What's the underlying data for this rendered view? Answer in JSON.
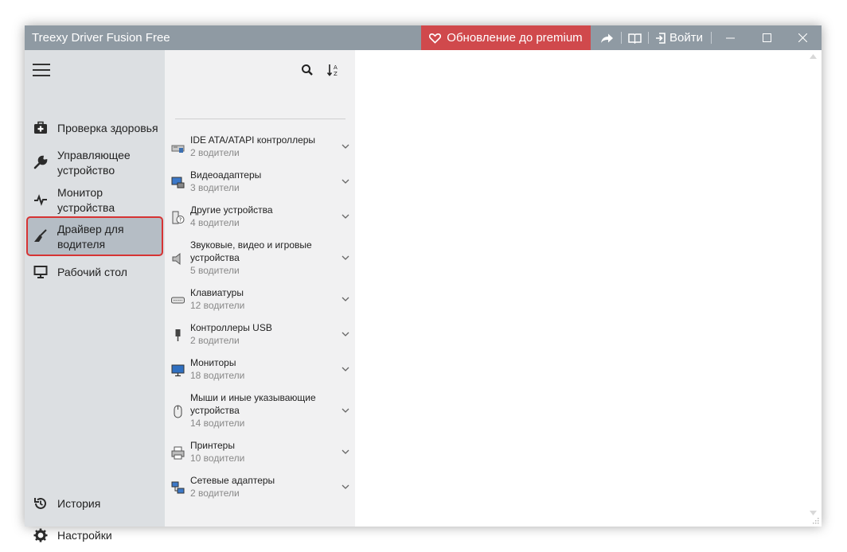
{
  "window": {
    "title": "Treexy Driver Fusion Free",
    "premium_label": "Обновление до premium",
    "login_label": "Войти",
    "colors": {
      "titlebar": "#8f9aa3",
      "premium": "#d0494c",
      "sidebar": "#dcdfe2",
      "list_panel": "#f1f1f2",
      "active_item": "#b5bdc5",
      "highlight_border": "#d63333"
    }
  },
  "sidebar": {
    "items": [
      {
        "label": "Проверка здоровья",
        "icon": "first-aid-kit-icon"
      },
      {
        "label": "Управляющее устройство",
        "icon": "wrench-icon"
      },
      {
        "label": "Монитор устройства",
        "icon": "pulse-icon"
      },
      {
        "label": "Драйвер для водителя",
        "icon": "broom-icon",
        "active": true
      },
      {
        "label": "Рабочий стол",
        "icon": "monitor-icon"
      }
    ],
    "bottom": [
      {
        "label": "История",
        "icon": "history-icon"
      },
      {
        "label": "Настройки",
        "icon": "gear-icon"
      }
    ]
  },
  "devices": [
    {
      "name": "IDE ATA/ATAPI контроллеры",
      "count": "2 водители",
      "icon": "ide-controller-icon"
    },
    {
      "name": "Видеоадаптеры",
      "count": "3 водители",
      "icon": "display-adapter-icon"
    },
    {
      "name": "Другие устройства",
      "count": "4 водители",
      "icon": "unknown-device-icon"
    },
    {
      "name": "Звуковые, видео и игровые устройства",
      "count": "5 водители",
      "icon": "speaker-icon"
    },
    {
      "name": "Клавиатуры",
      "count": "12 водители",
      "icon": "keyboard-icon"
    },
    {
      "name": "Контроллеры USB",
      "count": "2 водители",
      "icon": "usb-icon"
    },
    {
      "name": "Мониторы",
      "count": "18 водители",
      "icon": "monitor-icon"
    },
    {
      "name": "Мыши и иные указывающие устройства",
      "count": "14 водители",
      "icon": "mouse-icon"
    },
    {
      "name": "Принтеры",
      "count": "10 водители",
      "icon": "printer-icon"
    },
    {
      "name": "Сетевые адаптеры",
      "count": "2 водители",
      "icon": "network-adapter-icon"
    }
  ]
}
